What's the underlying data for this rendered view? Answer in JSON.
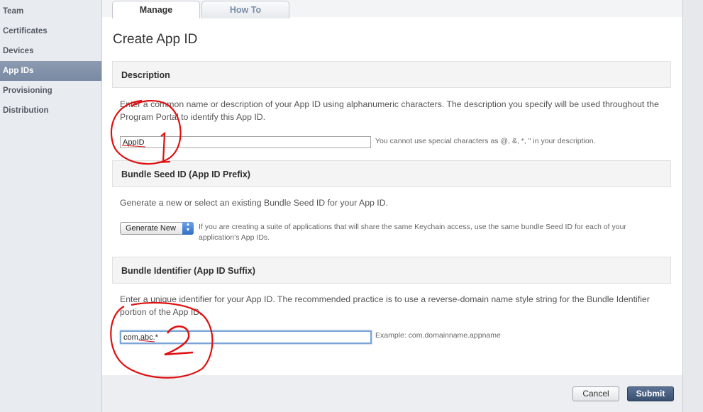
{
  "sidebar": {
    "items": [
      {
        "label": "Team"
      },
      {
        "label": "Certificates"
      },
      {
        "label": "Devices"
      },
      {
        "label": "App IDs"
      },
      {
        "label": "Provisioning"
      },
      {
        "label": "Distribution"
      }
    ],
    "active": "App IDs"
  },
  "tabs": [
    {
      "label": "Manage"
    },
    {
      "label": "How To"
    }
  ],
  "page_title": "Create App ID",
  "description": {
    "header": "Description",
    "help": "Enter a common name or description of your App ID using alphanumeric characters. The description you specify will be used throughout the Program Portal to identify this App ID.",
    "value": "AppID",
    "note": "You cannot use special characters as @, &, *, \" in your description."
  },
  "seed": {
    "header": "Bundle Seed ID (App ID Prefix)",
    "help": "Generate a new or select an existing Bundle Seed ID for your App ID.",
    "selected": "Generate New",
    "note": "If you are creating a suite of applications that will share the same Keychain access, use the same bundle Seed ID for each of your application's App IDs."
  },
  "identifier": {
    "header": "Bundle Identifier (App ID Suffix)",
    "help": "Enter a unique identifier for your App ID. The recommended practice is to use a reverse-domain name style string for the Bundle Identifier portion of the App ID.",
    "value": "com.abc.*",
    "note": "Example: com.domainname.appname"
  },
  "buttons": {
    "cancel": "Cancel",
    "submit": "Submit"
  },
  "annotations": {
    "mark_1": "1",
    "mark_2": "2",
    "color": "#e01010"
  }
}
